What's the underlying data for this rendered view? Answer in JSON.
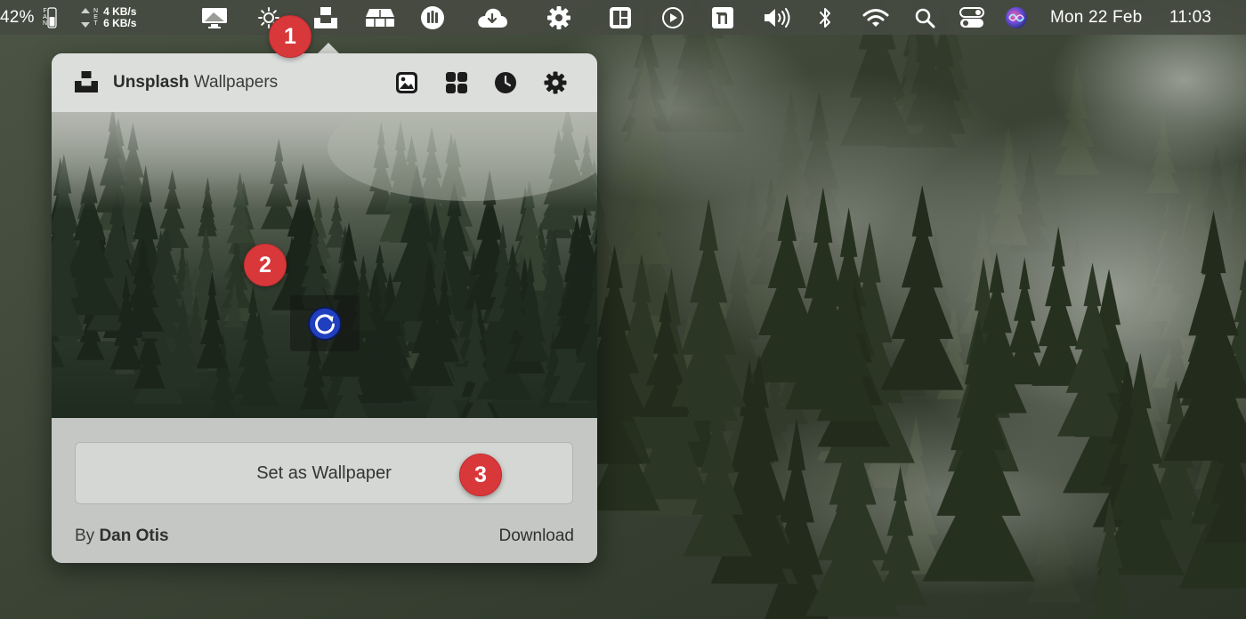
{
  "menubar": {
    "battery_percent": "42%",
    "fan_label_f": "F",
    "fan_label_a": "A",
    "fan_label_n": "N",
    "net_label_n": "N",
    "net_label_e": "E",
    "net_label_t": "T",
    "upload_speed": "4 KB/s",
    "download_speed": "6 KB/s",
    "date": "Mon 22 Feb",
    "time": "11:03",
    "icons": [
      "display-icon",
      "brightness-icon",
      "unsplash-icon",
      "drawers-icon",
      "toggl-icon",
      "cloud-icon",
      "gear-icon",
      "layout-icon",
      "play-icon",
      "notion-icon",
      "volume-icon",
      "bluetooth-icon",
      "wifi-icon",
      "search-icon",
      "control-center-icon",
      "siri-icon"
    ]
  },
  "popover": {
    "title_bold": "Unsplash",
    "title_rest": " Wallpapers",
    "header_icons": [
      "image-icon",
      "grid-icon",
      "clock-icon",
      "settings-icon"
    ],
    "set_wallpaper_label": "Set as Wallpaper",
    "author_prefix": "By ",
    "author_name": "Dan Otis",
    "download_label": "Download"
  },
  "annotations": {
    "badge1": "1",
    "badge2": "2",
    "badge3": "3",
    "badge_color": "#d9383b"
  },
  "colors": {
    "menubar_bg": "#464a42",
    "popover_header": "#dcdedb",
    "popover_footer": "#c4c7c3",
    "refresh_accent": "#1f3fbf"
  }
}
